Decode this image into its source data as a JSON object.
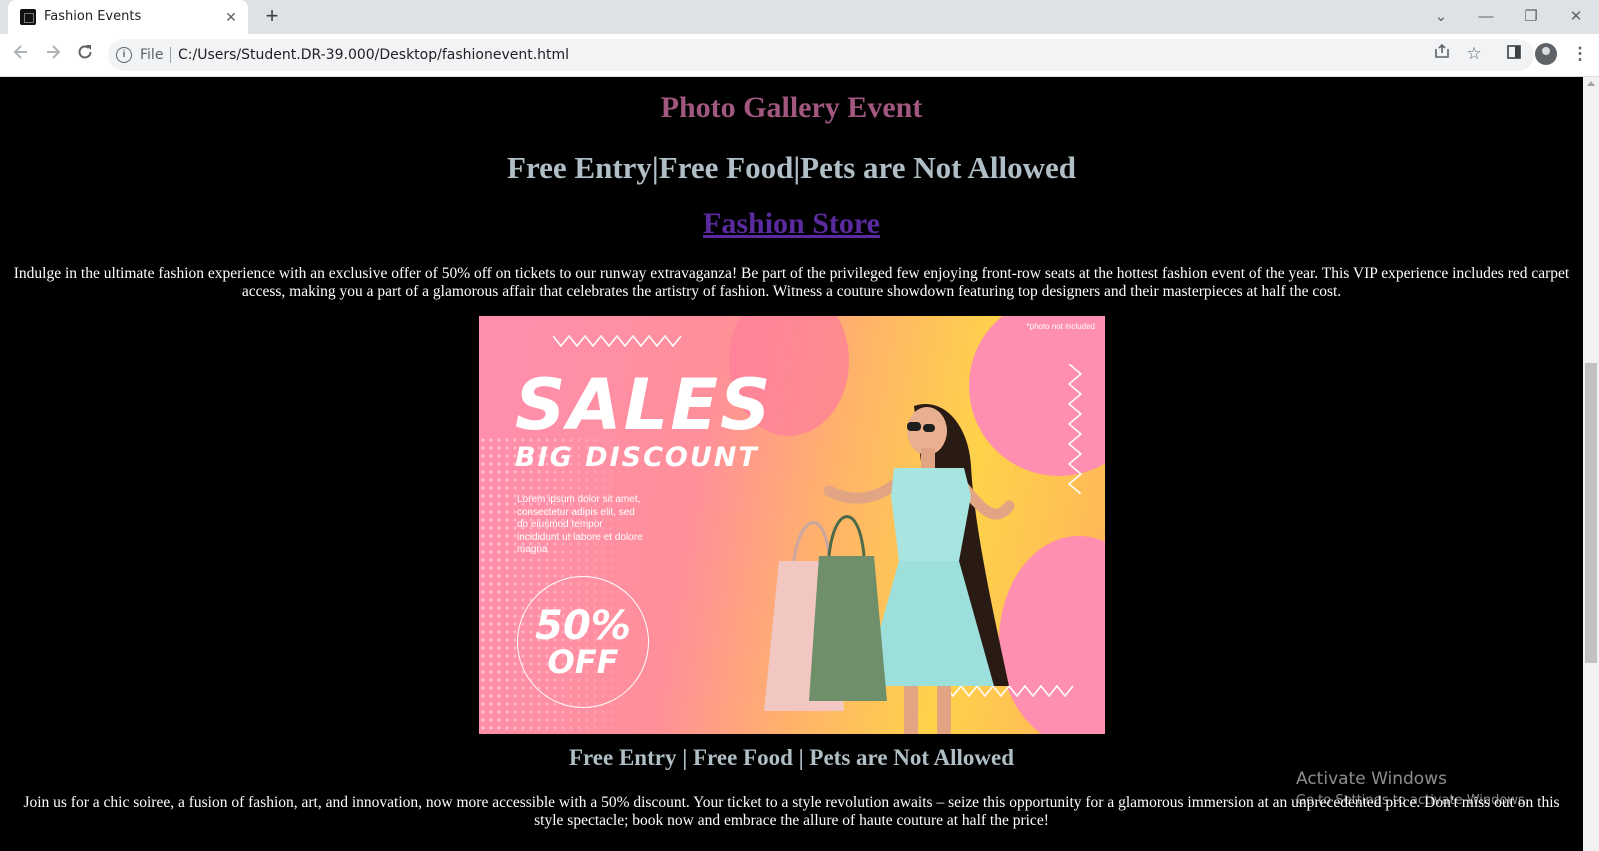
{
  "browser": {
    "tab_title": "Fashion Events",
    "tab_close": "✕",
    "new_tab": "+",
    "scheme_label": "File",
    "url": "C:/Users/Student.DR-39.000/Desktop/fashionevent.html",
    "window_controls": {
      "tabs_search": "⌄",
      "minimize": "—",
      "restore": "❐",
      "close": "✕"
    },
    "icons": {
      "back": "back-arrow-icon",
      "forward": "forward-arrow-icon",
      "reload": "reload-icon",
      "info": "info-icon",
      "share": "share-icon",
      "bookmark": "star-icon",
      "side_panel": "side-panel-icon",
      "profile": "profile-icon",
      "menu": "kebab-menu-icon"
    }
  },
  "page": {
    "gallery_title": "Photo Gallery Event",
    "event_info": "Free Entry|Free Food|Pets are Not Allowed",
    "store_link": "Fashion Store",
    "intro_text": "Indulge in the ultimate fashion experience with an exclusive offer of 50% off on tickets to our runway extravaganza! Be part of the privileged few enjoying front-row seats at the hottest fashion event of the year. This VIP experience includes red carpet access, making you a part of a glamorous affair that celebrates the artistry of fashion. Witness a couture showdown featuring top designers and their masterpieces at half the cost.",
    "banner": {
      "tag": "*photo not included",
      "sales": "SALES",
      "big_discount": "BIG DISCOUNT",
      "lorem": "Lorem ipsum dolor sit amet, consectetur adipis elit, sed do eiusmod tempor incididunt ut labore et dolore magna",
      "percent": "50%",
      "off": "OFF"
    },
    "event_info_2": "Free Entry | Free Food | Pets are Not Allowed",
    "outro_text": "Join us for a chic soiree, a fusion of fashion, art, and innovation, now more accessible with a 50% discount. Your ticket to a style revolution awaits – seize this opportunity for a glamorous immersion at an unprecedented price. Don't miss out on this style spectacle; book now and embrace the allure of haute couture at half the price!"
  },
  "watermark": {
    "line1": "Activate Windows",
    "line2": "Go to Settings to activate Windows."
  },
  "colors": {
    "gallery_title": "#a2577f",
    "event_info": "#b0bec5",
    "store_link": "#5a2a9e",
    "page_bg": "#000000"
  }
}
